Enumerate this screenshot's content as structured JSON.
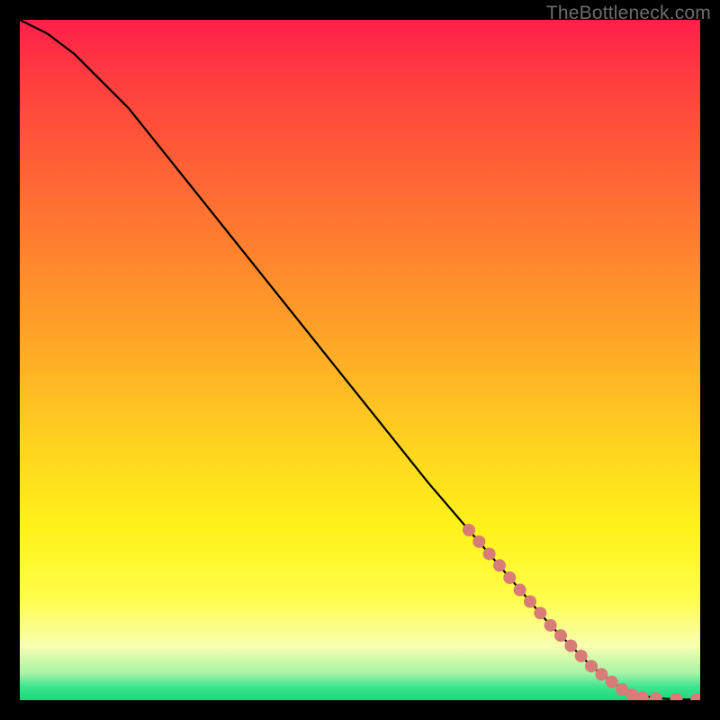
{
  "watermark_text": "TheBottleneck.com",
  "chart_data": {
    "type": "line",
    "title": "",
    "xlabel": "",
    "ylabel": "",
    "xlim": [
      0,
      100
    ],
    "ylim": [
      0,
      100
    ],
    "series": [
      {
        "name": "curve",
        "x": [
          0,
          4,
          8,
          12,
          16,
          20,
          28,
          36,
          44,
          52,
          60,
          66,
          72,
          78,
          84,
          88,
          91,
          93.5,
          95,
          97,
          100
        ],
        "y": [
          100,
          98,
          95,
          91,
          87,
          82,
          72,
          62,
          52,
          42,
          32,
          25,
          18,
          11,
          5,
          2,
          0.8,
          0.3,
          0.2,
          0.1,
          0.1
        ]
      }
    ],
    "marker_points": {
      "comment": "Salmon dotted segment near lower-right of curve, then dashed run along bottom",
      "points": [
        {
          "x": 66,
          "y": 25
        },
        {
          "x": 67.5,
          "y": 23.3
        },
        {
          "x": 69,
          "y": 21.5
        },
        {
          "x": 70.5,
          "y": 19.8
        },
        {
          "x": 72,
          "y": 18
        },
        {
          "x": 73.5,
          "y": 16.2
        },
        {
          "x": 75,
          "y": 14.5
        },
        {
          "x": 76.5,
          "y": 12.8
        },
        {
          "x": 78,
          "y": 11
        },
        {
          "x": 79.5,
          "y": 9.5
        },
        {
          "x": 81,
          "y": 8
        },
        {
          "x": 82.5,
          "y": 6.5
        },
        {
          "x": 84,
          "y": 5
        },
        {
          "x": 85.5,
          "y": 3.8
        },
        {
          "x": 87,
          "y": 2.7
        },
        {
          "x": 88.5,
          "y": 1.6
        },
        {
          "x": 90,
          "y": 0.8
        },
        {
          "x": 91.5,
          "y": 0.4
        },
        {
          "x": 93.5,
          "y": 0.25
        },
        {
          "x": 96.5,
          "y": 0.15
        },
        {
          "x": 99.5,
          "y": 0.1
        }
      ],
      "radius": 7
    }
  },
  "colors": {
    "dot": "#d87c78",
    "curve": "#000000"
  }
}
